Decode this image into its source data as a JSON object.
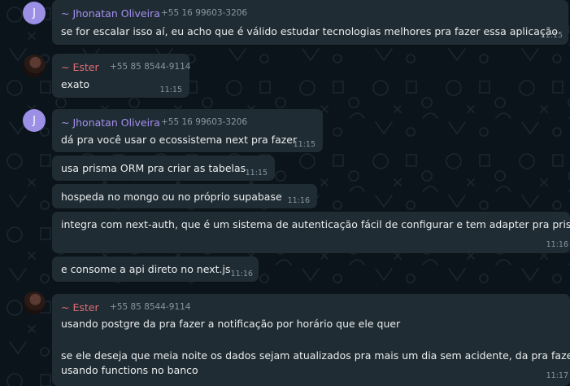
{
  "theme": {
    "background": "#0b141a",
    "bubble": "#202c33",
    "text": "#e9edef",
    "muted": "#8696a0",
    "jhonatan_color": "#a48ff0",
    "ester_color": "#e06c75",
    "avatar_color": "#9b8fe6"
  },
  "messages": [
    {
      "sender": "~ Jhonatan Oliveira",
      "phone": "+55 16 99603-3206",
      "avatar": "J",
      "text": "se for escalar isso aí, eu acho que é válido estudar tecnologias melhores pra fazer essa aplicação",
      "time": "11:15"
    },
    {
      "sender": "~ Ester",
      "phone": "+55 85 8544-9114",
      "avatar": "photo",
      "text": "exato",
      "time": "11:15"
    },
    {
      "sender": "~ Jhonatan Oliveira",
      "phone": "+55 16 99603-3206",
      "avatar": "J",
      "text": "dá pra você usar o ecossistema next pra fazer",
      "time": "11:15"
    },
    {
      "text": "usa prisma ORM pra criar as tabelas",
      "time": "11:15"
    },
    {
      "text": "hospeda no mongo ou no próprio supabase",
      "time": "11:16"
    },
    {
      "text": "integra com next-auth, que é um sistema de autenticação fácil de configurar e tem adapter pra prisma",
      "time": "11:16"
    },
    {
      "text": "e consome a api direto no next.js",
      "time": "11:16"
    },
    {
      "sender": "~ Ester",
      "phone": "+55 85 8544-9114",
      "avatar": "photo",
      "lines": [
        "usando postgre da pra fazer a notificação por horário que ele quer",
        "se ele deseja que meia noite os dados sejam atualizados pra mais um dia sem acidente, da pra fazer",
        "usando functions no banco"
      ],
      "time": "11:17"
    }
  ]
}
